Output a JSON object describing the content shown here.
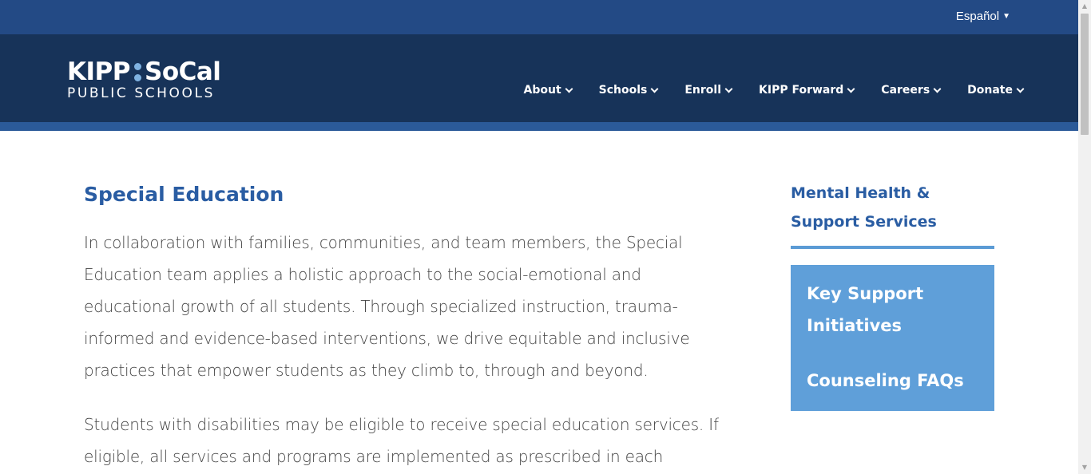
{
  "topbar": {
    "language_label": "Español"
  },
  "logo": {
    "main_left": "KIPP",
    "main_right": "SoCal",
    "sub": "PUBLIC SCHOOLS"
  },
  "nav": {
    "items": [
      {
        "label": "About"
      },
      {
        "label": "Schools"
      },
      {
        "label": "Enroll"
      },
      {
        "label": "KIPP Forward"
      },
      {
        "label": "Careers"
      },
      {
        "label": "Donate"
      }
    ]
  },
  "main": {
    "title": "Special Education",
    "paragraphs": [
      "In collaboration with families, communities, and team members, the Special Education team applies a holistic approach to the social-emotional and educational growth of all students. Through specialized instruction, trauma-informed and evidence-based interventions, we drive equitable and inclusive practices that empower students as they climb to, through and beyond.",
      "Students with disabilities may be eligible to receive special education services.  If eligible, all services and programs are implemented as prescribed in each"
    ]
  },
  "sidebar": {
    "title": "Mental Health & Support Services",
    "links": [
      {
        "label": "Key Support Initiatives"
      },
      {
        "label": "Counseling FAQs"
      }
    ]
  },
  "colors": {
    "topbar": "#234a85",
    "header": "#173359",
    "accent_blue": "#2a5da3",
    "sidebar_box": "#5f9fd9"
  }
}
